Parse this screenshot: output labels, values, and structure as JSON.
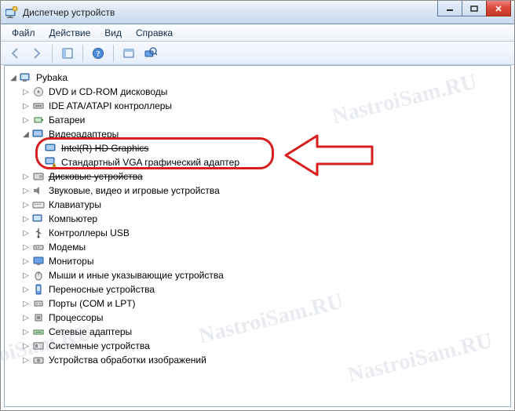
{
  "window": {
    "title": "Диспетчер устройств"
  },
  "menu": {
    "file": "Файл",
    "action": "Действие",
    "view": "Вид",
    "help": "Справка"
  },
  "tree": {
    "root": "Pybaka",
    "items": [
      "DVD и CD-ROM дисководы",
      "IDE ATA/ATAPI контроллеры",
      "Батареи",
      "Видеоадаптеры",
      "Дисковые устройства",
      "Звуковые, видео и игровые устройства",
      "Клавиатуры",
      "Компьютер",
      "Контроллеры USB",
      "Модемы",
      "Мониторы",
      "Мыши и иные указывающие устройства",
      "Переносные устройства",
      "Порты (COM и LPT)",
      "Процессоры",
      "Сетевые адаптеры",
      "Системные устройства",
      "Устройства обработки изображений"
    ],
    "video_children": {
      "intel": "Intel(R) HD Graphics",
      "vga": "Стандартный VGA графический адаптер"
    }
  },
  "watermark": "NastroiSam.RU"
}
